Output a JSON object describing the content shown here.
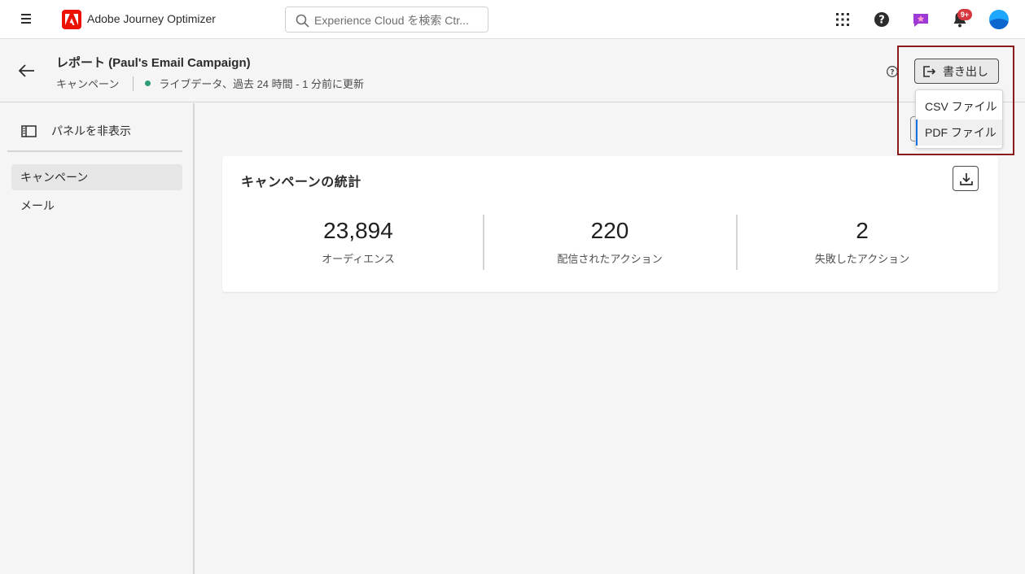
{
  "topbar": {
    "app_title": "Adobe Journey Optimizer",
    "search_placeholder": "Experience Cloud を検索 Ctr...",
    "notification_count": "9+"
  },
  "header": {
    "title": "レポート (Paul's Email Campaign)",
    "type": "キャンペーン",
    "status": "ライブデータ、過去 24 時間 - 1 分前に更新",
    "export_label": "書き出し",
    "export_menu": [
      "CSV ファイル",
      "PDF ファイル"
    ]
  },
  "sidebar": {
    "toggle_label": "パネルを非表示",
    "items": [
      {
        "label": "キャンペーン",
        "selected": true
      },
      {
        "label": "メール",
        "selected": false
      }
    ]
  },
  "stats": {
    "title": "キャンペーンの統計",
    "metrics": [
      {
        "value": "23,894",
        "label": "オーディエンス"
      },
      {
        "value": "220",
        "label": "配信されたアクション"
      },
      {
        "value": "2",
        "label": "失敗したアクション"
      }
    ]
  },
  "colors": {
    "brand_red": "#eb1000",
    "live_dot": "#2d9d78",
    "badge": "#d7373f",
    "menu_accent": "#1473e6",
    "highlight_box": "#8b1a1a"
  }
}
